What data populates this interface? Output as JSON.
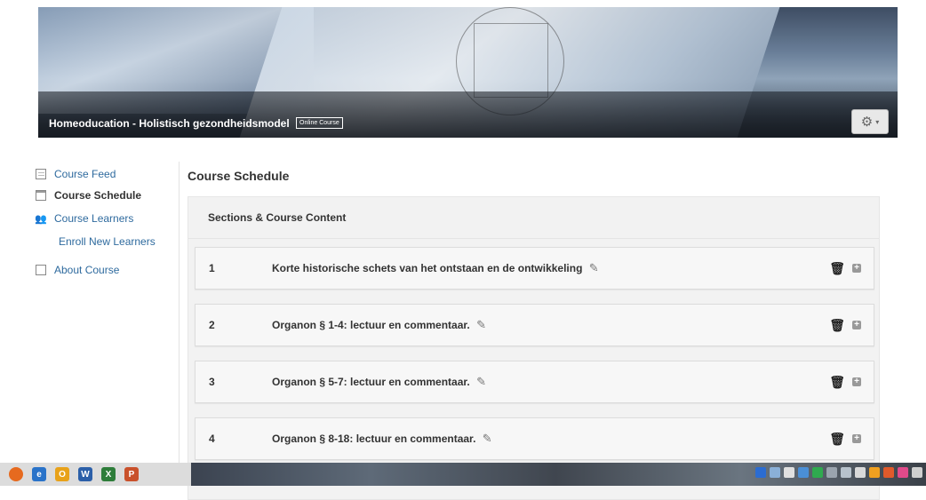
{
  "banner": {
    "title": "Homeoducation - Holistisch gezondheidsmodel",
    "badge": "Online Course",
    "gear_caret": "▾"
  },
  "sidebar": {
    "items": [
      {
        "label": "Course Feed",
        "icon": "feed-icon"
      },
      {
        "label": "Course Schedule",
        "icon": "schedule-icon",
        "active": true
      },
      {
        "label": "Course Learners",
        "icon": "learners-icon"
      },
      {
        "label": "Enroll New Learners",
        "icon": null
      },
      {
        "label": "About Course",
        "icon": "about-icon"
      }
    ]
  },
  "main": {
    "heading": "Course Schedule",
    "panel_title": "Sections & Course Content",
    "sections": [
      {
        "num": "1",
        "title": "Korte historische schets van het ontstaan en de ontwikkeling"
      },
      {
        "num": "2",
        "title": "Organon § 1-4: lectuur en commentaar."
      },
      {
        "num": "3",
        "title": "Organon § 5-7: lectuur en commentaar."
      },
      {
        "num": "4",
        "title": "Organon § 8-18: lectuur en commentaar."
      }
    ]
  },
  "taskbar": {
    "apps": [
      {
        "name": "firefox-icon",
        "color": "#e66a1f",
        "glyph": ""
      },
      {
        "name": "ie-icon",
        "color": "#2a73c9",
        "glyph": "e"
      },
      {
        "name": "outlook-icon",
        "color": "#e8a21a",
        "glyph": "O"
      },
      {
        "name": "word-icon",
        "color": "#2b5fa8",
        "glyph": "W"
      },
      {
        "name": "excel-icon",
        "color": "#2e7d3a",
        "glyph": "X"
      },
      {
        "name": "powerpoint-icon",
        "color": "#c9512b",
        "glyph": "P"
      }
    ]
  },
  "colors": {
    "link": "#2e6a9e",
    "panel_bg": "#f2f2f2"
  }
}
